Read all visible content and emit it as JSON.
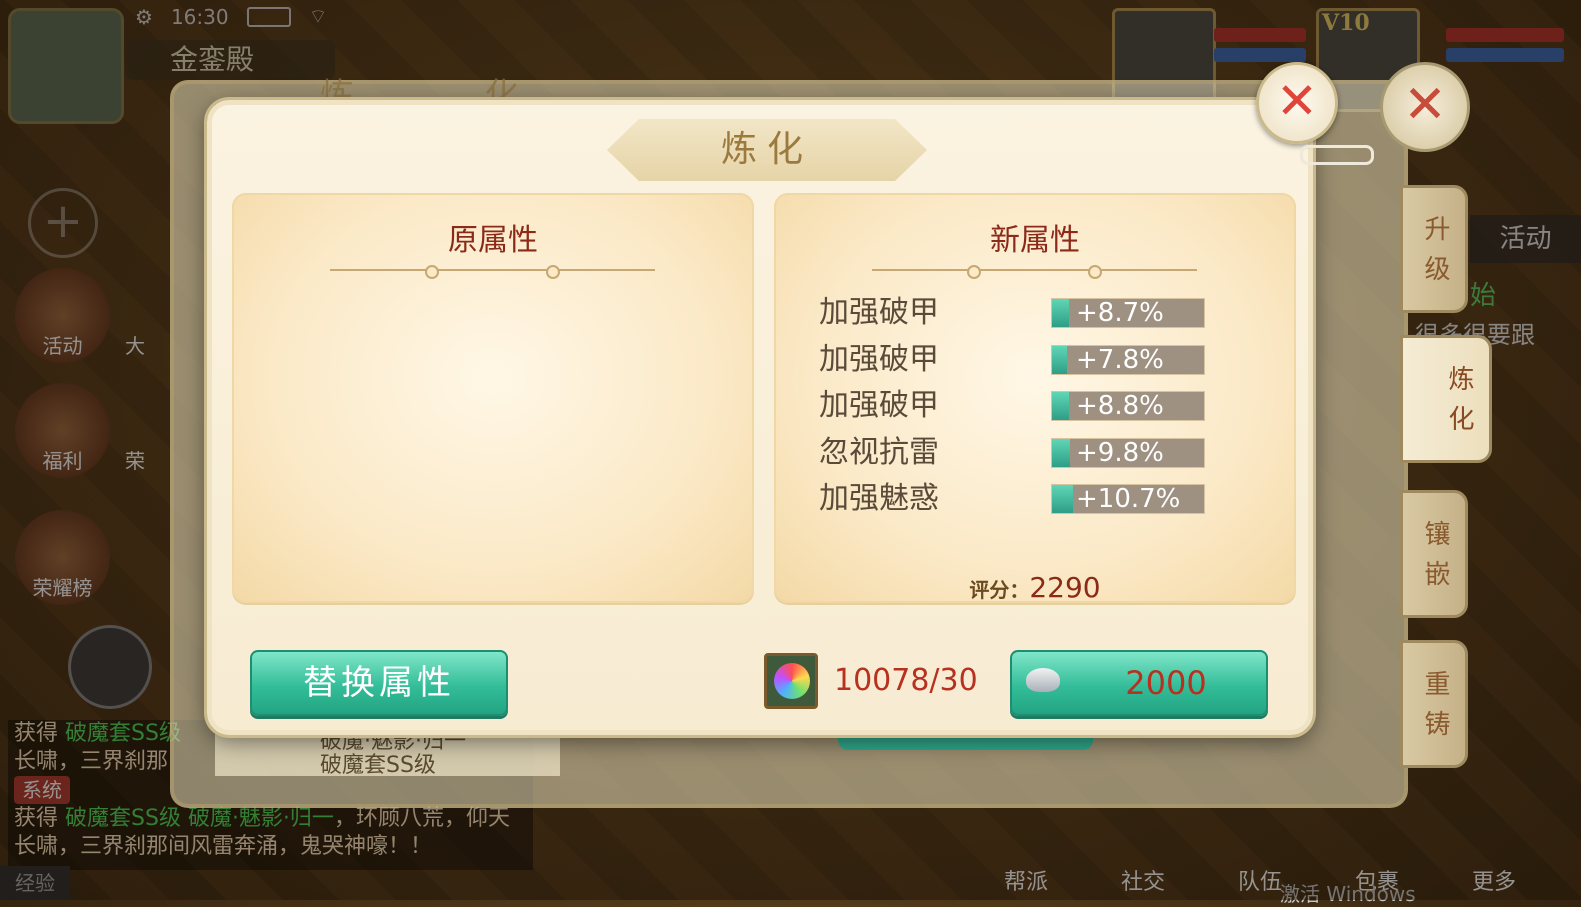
{
  "status_bar": {
    "time": "16:30"
  },
  "location": "金銮殿",
  "left_menu": {
    "activity": "活动",
    "welfare": "福利",
    "ranking": "荣耀榜",
    "partial_left_1": "大",
    "partial_left_2": "荣"
  },
  "vip": "V10",
  "chat": {
    "tag": "系统",
    "line1_prefix": "获得",
    "line1_item": "破魔套SS级",
    "line2": "长啸，三界刹那",
    "line3_prefix": "获得",
    "line3_item": "破魔套SS级 破魔·魅影·归一",
    "line3_tail": "，环顾八荒，仰天",
    "line4": "长啸，三界刹那间风雷奔涌，鬼哭神嚎！！"
  },
  "exp_label": "经验",
  "bottom_menu": [
    "帮派",
    "社交",
    "队伍",
    "包裹",
    "更多"
  ],
  "right_hud": {
    "activity": "活动",
    "line1": "始",
    "line2": "很多很要跟"
  },
  "windows_watermark": "激活 Windows",
  "back_panel": {
    "title": "炼 化",
    "item_name": "破魔·魅影·归一",
    "item_sub": "破魔套SS级"
  },
  "side_tabs": {
    "upgrade": "升级",
    "refine": "炼化",
    "inlay": "镶嵌",
    "recast": "重铸"
  },
  "dialog": {
    "title": "炼化",
    "close_glyph": "✕",
    "original_header": "原属性",
    "new_header": "新属性",
    "new_attributes": [
      {
        "name": "加强破甲",
        "value": "+8.7%",
        "fill": 0.11
      },
      {
        "name": "加强破甲",
        "value": "+7.8%",
        "fill": 0.1
      },
      {
        "name": "加强破甲",
        "value": "+8.8%",
        "fill": 0.11
      },
      {
        "name": "忽视抗雷",
        "value": "+9.8%",
        "fill": 0.12
      },
      {
        "name": "加强魅惑",
        "value": "+10.7%",
        "fill": 0.14
      }
    ],
    "score_label": "评分：",
    "score_value": "2290",
    "replace_button": "替换属性",
    "material_count": "10078/30",
    "cost_value": "2000"
  },
  "colors": {
    "accent_teal": "#34bd99",
    "value_red": "#b8301f",
    "header_red": "#8b2a18",
    "close_red": "#e0453a"
  },
  "icons": {
    "material": "rainbow-orb-icon",
    "currency": "silver-ingot-icon",
    "close": "close-icon"
  }
}
